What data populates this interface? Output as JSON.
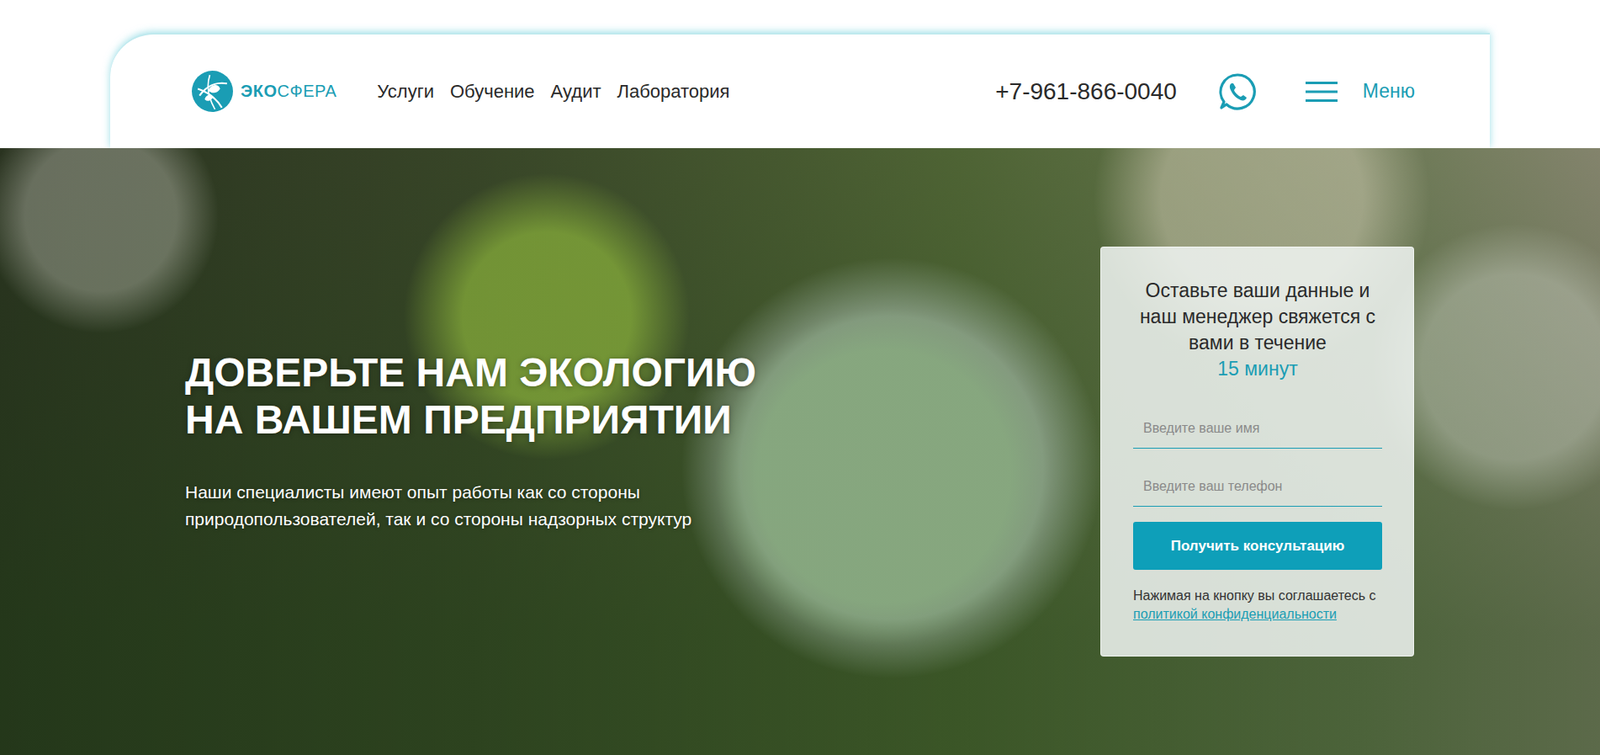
{
  "header": {
    "logo": {
      "accent": "ЭКО",
      "rest": "СФЕРА"
    },
    "nav": [
      {
        "label": "Услуги"
      },
      {
        "label": "Обучение"
      },
      {
        "label": "Аудит"
      },
      {
        "label": "Лаборатория"
      }
    ],
    "phone": "+7-961-866-0040",
    "menu_label": "Меню"
  },
  "hero": {
    "title_lines": [
      "ДОВЕРЬТЕ НАМ ЭКОЛОГИЮ",
      "НА ВАШЕМ ПРЕДПРИЯТИИ"
    ],
    "subtitle_lines": [
      "Наши специалисты имеют опыт работы как со стороны",
      "природопользователей, так и со стороны надзорных структур"
    ]
  },
  "form": {
    "title": "Оставьте ваши данные и наш менеджер свяжется с вами в течение",
    "title_accent": "15 минут",
    "fields": [
      {
        "placeholder": "Введите ваше имя"
      },
      {
        "placeholder": "Введите ваш телефон"
      }
    ],
    "button": "Получить консультацию",
    "consent": "Нажимая на кнопку вы соглашаетесь с",
    "consent_link": "политикой конфиденциальности"
  }
}
